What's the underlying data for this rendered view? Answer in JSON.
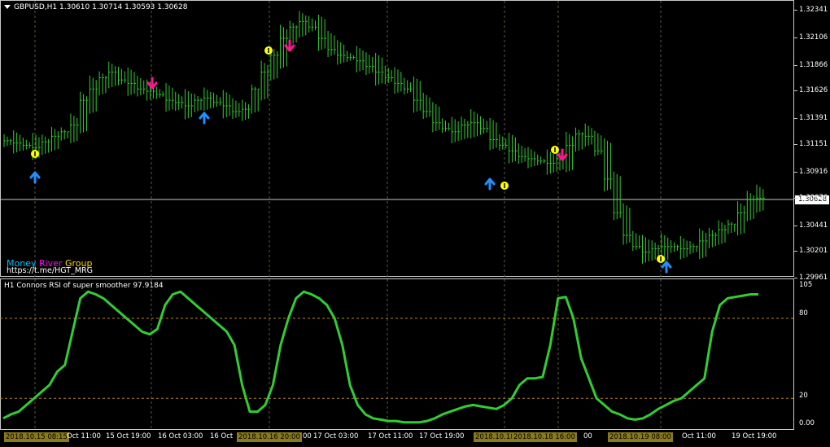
{
  "chart_header": {
    "symbol_info": "GBPUSD,H1  1.30610 1.30714 1.30593 1.30628"
  },
  "indicator_header": {
    "title": "H1 Connors RSI of super smoother 97.9184"
  },
  "brand": {
    "word1": "Money",
    "word2": "River",
    "word3": "Group",
    "url": "https://t.me/HGT_MRG",
    "color1": "#00bfff",
    "color2": "#ff00ff",
    "color3": "#ffd700"
  },
  "colors": {
    "candle": "#32cd32",
    "rsi": "#32cd32",
    "up_arrow": "#1e90ff",
    "down_arrow": "#ff1493",
    "signal_circle": "#ffff00"
  },
  "price_axis": [
    "1.32341",
    "1.32106",
    "1.31866",
    "1.31626",
    "1.31391",
    "1.31151",
    "1.30916",
    "1.30676",
    "1.30441",
    "1.30201",
    "1.29961"
  ],
  "current_price": "1.30628",
  "indicator_axis": [
    "105",
    "80",
    "20",
    "0.00"
  ],
  "time_axis": [
    {
      "label": "2018.10.15 08:15",
      "highlight": true
    },
    {
      "label": "Oct 11:00",
      "highlight": false
    },
    {
      "label": "15 Oct 19:00",
      "highlight": false
    },
    {
      "label": "16 Oct 03:00",
      "highlight": false
    },
    {
      "label": "16 Oct",
      "highlight": false
    },
    {
      "label": "2018.10.16 20:00",
      "highlight": true
    },
    {
      "label": "00",
      "highlight": false
    },
    {
      "label": "17 Oct 03:00",
      "highlight": false
    },
    {
      "label": "17 Oct 11:00",
      "highlight": false
    },
    {
      "label": "17 Oct 19:00",
      "highlight": false
    },
    {
      "label": "2018.10.18 08",
      "highlight": true
    },
    {
      "label": "2018.10.18 16:00",
      "highlight": true
    },
    {
      "label": "00",
      "highlight": false
    },
    {
      "label": "2018.10.19 08:00",
      "highlight": true
    },
    {
      "label": "Oct 11:00",
      "highlight": false
    },
    {
      "label": "19 Oct 19:00",
      "highlight": false
    }
  ],
  "chart_data": {
    "type": "line",
    "title": "GBPUSD,H1",
    "ohlc_bars_approx_close": [
      1.3114,
      1.3112,
      1.311,
      1.3108,
      1.3113,
      1.3118,
      1.3122,
      1.3128,
      1.315,
      1.316,
      1.317,
      1.3175,
      1.3168,
      1.3165,
      1.316,
      1.3158,
      1.3155,
      1.315,
      1.3148,
      1.3145,
      1.315,
      1.3152,
      1.3148,
      1.3145,
      1.314,
      1.3142,
      1.316,
      1.3175,
      1.319,
      1.3205,
      1.3215,
      1.322,
      1.3215,
      1.3205,
      1.3195,
      1.319,
      1.3188,
      1.3185,
      1.318,
      1.3175,
      1.317,
      1.3165,
      1.316,
      1.315,
      1.314,
      1.313,
      1.3125,
      1.3122,
      1.3128,
      1.313,
      1.3125,
      1.3115,
      1.311,
      1.3105,
      1.31,
      1.3098,
      1.3096,
      1.3094,
      1.3098,
      1.311,
      1.312,
      1.3118,
      1.3105,
      1.308,
      1.305,
      1.303,
      1.302,
      1.3015,
      1.3018,
      1.302,
      1.302,
      1.3018,
      1.302,
      1.3025,
      1.303,
      1.3035,
      1.304,
      1.305,
      1.3062,
      1.3063
    ],
    "indicator": {
      "name": "H1 Connors RSI of super smoother",
      "value": 97.9184,
      "levels": [
        80,
        20
      ],
      "ylim": [
        0,
        105
      ],
      "values": [
        5,
        8,
        10,
        15,
        20,
        25,
        30,
        40,
        45,
        70,
        95,
        100,
        98,
        95,
        90,
        85,
        80,
        75,
        70,
        68,
        72,
        90,
        98,
        100,
        95,
        90,
        85,
        80,
        75,
        70,
        60,
        30,
        10,
        10,
        15,
        30,
        60,
        80,
        95,
        100,
        98,
        95,
        90,
        80,
        60,
        30,
        15,
        8,
        5,
        4,
        3,
        3,
        2,
        2,
        2,
        3,
        5,
        8,
        10,
        12,
        14,
        15,
        14,
        13,
        12,
        15,
        20,
        30,
        35,
        35,
        36,
        60,
        95,
        96,
        80,
        50,
        35,
        20,
        15,
        10,
        8,
        5,
        4,
        5,
        8,
        12,
        15,
        18,
        20,
        25,
        30,
        35,
        70,
        90,
        95,
        96,
        97,
        98,
        98
      ]
    }
  }
}
